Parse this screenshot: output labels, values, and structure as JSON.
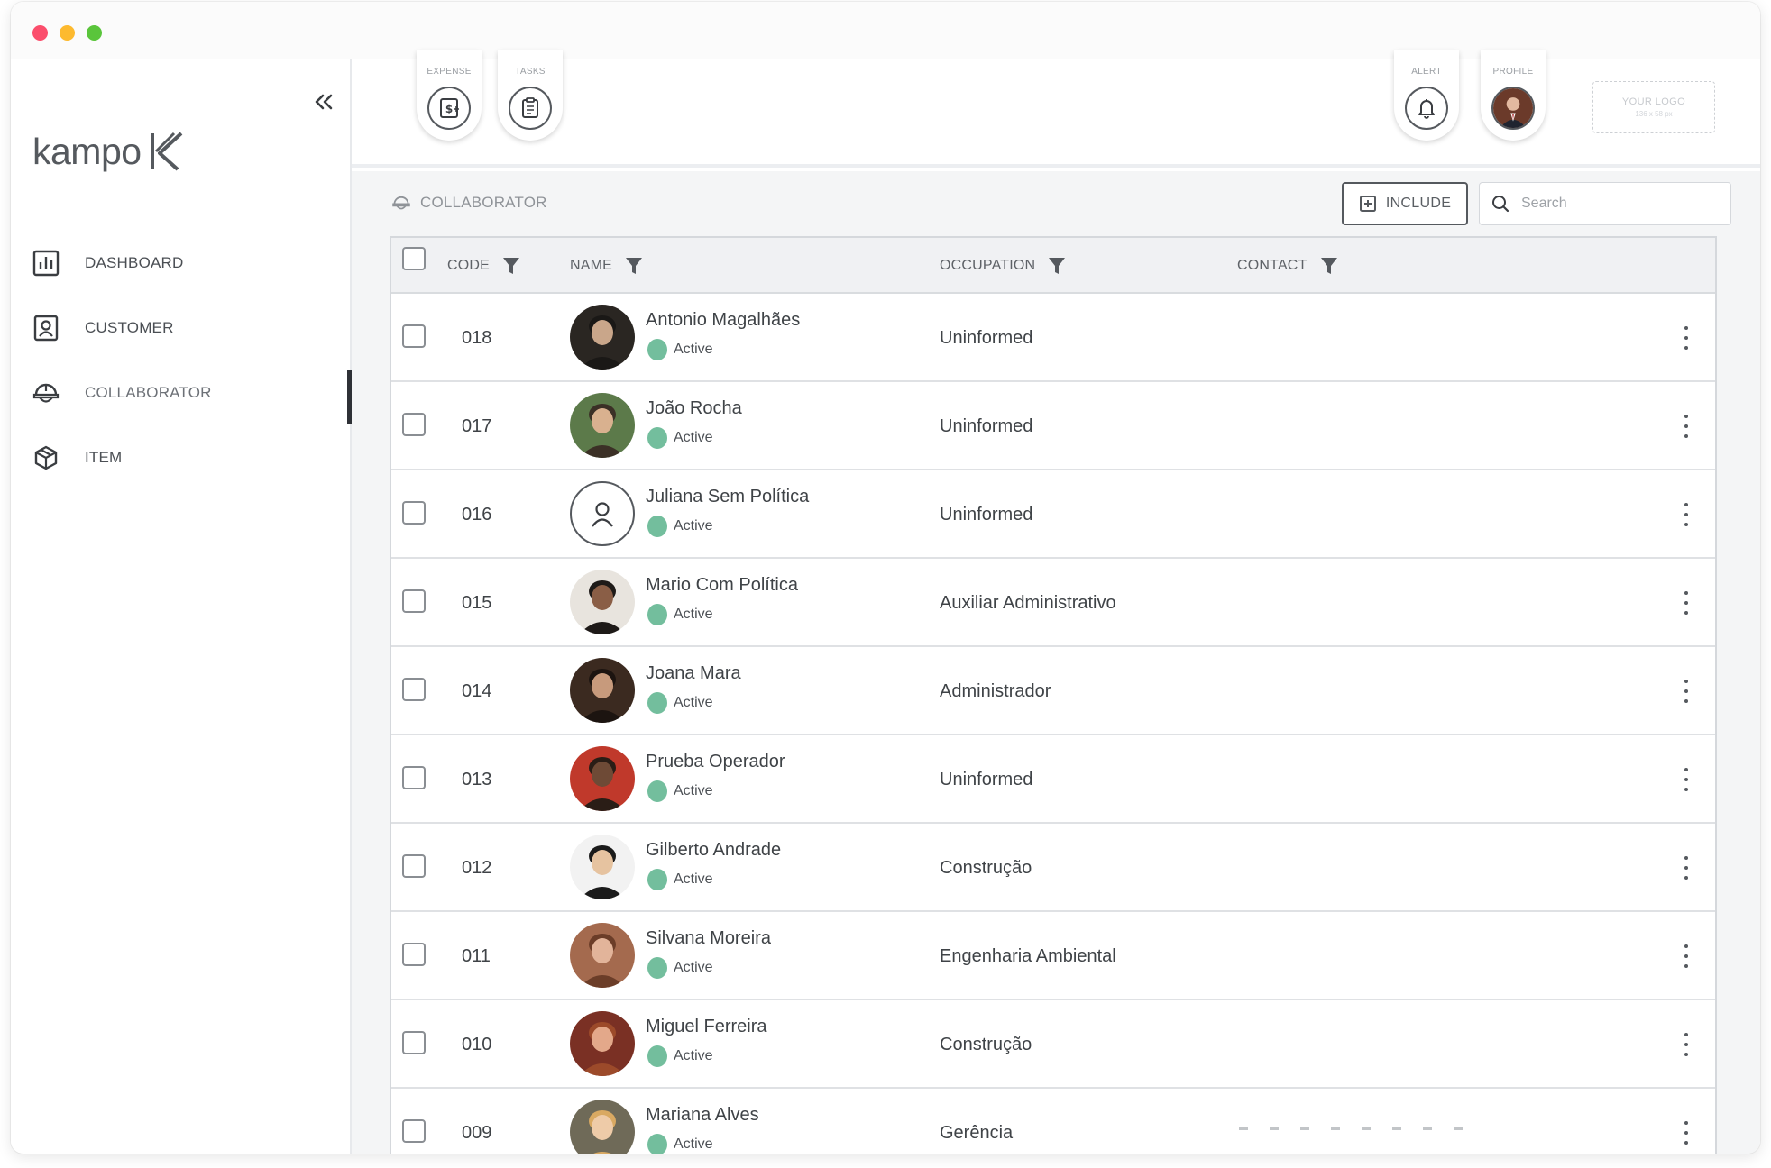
{
  "app": {
    "brand": "kampo",
    "colors": {
      "status_active": "#73be9d",
      "text_primary": "#3f4347",
      "text_muted": "#8f9398",
      "window_red": "#fb4e6c",
      "window_yellow": "#fdba2f",
      "window_green": "#5ac53b"
    }
  },
  "sidebar": {
    "collapse_icon": "double-chevron-left-icon",
    "items": [
      {
        "label": "DASHBOARD",
        "icon": "bar-chart-icon"
      },
      {
        "label": "CUSTOMER",
        "icon": "contact-card-icon"
      },
      {
        "label": "COLLABORATOR",
        "icon": "hard-hat-icon",
        "active": true
      },
      {
        "label": "ITEM",
        "icon": "box-icon"
      }
    ]
  },
  "topbar": {
    "tabs_left": [
      {
        "label": "EXPENSE",
        "icon": "receipt-dollar-icon"
      },
      {
        "label": "TASKS",
        "icon": "clipboard-icon"
      }
    ],
    "tabs_right": [
      {
        "label": "ALERT",
        "icon": "bell-icon"
      },
      {
        "label": "PROFILE",
        "icon": "avatar"
      }
    ],
    "logo_placeholder": {
      "line1": "YOUR LOGO",
      "line2": "136 x 58 px"
    }
  },
  "main": {
    "section_title": "COLLABORATOR",
    "include_label": "INCLUDE",
    "search_placeholder": "Search",
    "columns": [
      "CODE",
      "NAME",
      "OCCUPATION",
      "CONTACT"
    ],
    "rows": [
      {
        "code": "018",
        "name": "Antonio Magalhães",
        "status": "Active",
        "occupation": "Uninformed"
      },
      {
        "code": "017",
        "name": "João Rocha",
        "status": "Active",
        "occupation": "Uninformed"
      },
      {
        "code": "016",
        "name": "Juliana Sem Política",
        "status": "Active",
        "occupation": "Uninformed",
        "default_avatar": true
      },
      {
        "code": "015",
        "name": "Mario Com Política",
        "status": "Active",
        "occupation": "Auxiliar Administrativo"
      },
      {
        "code": "014",
        "name": "Joana Mara",
        "status": "Active",
        "occupation": "Administrador"
      },
      {
        "code": "013",
        "name": "Prueba Operador",
        "status": "Active",
        "occupation": "Uninformed"
      },
      {
        "code": "012",
        "name": "Gilberto Andrade",
        "status": "Active",
        "occupation": "Construção"
      },
      {
        "code": "011",
        "name": "Silvana Moreira",
        "status": "Active",
        "occupation": "Engenharia Ambiental"
      },
      {
        "code": "010",
        "name": "Miguel Ferreira",
        "status": "Active",
        "occupation": "Construção"
      },
      {
        "code": "009",
        "name": "Mariana Alves",
        "status": "Active",
        "occupation": "Gerência"
      }
    ]
  }
}
